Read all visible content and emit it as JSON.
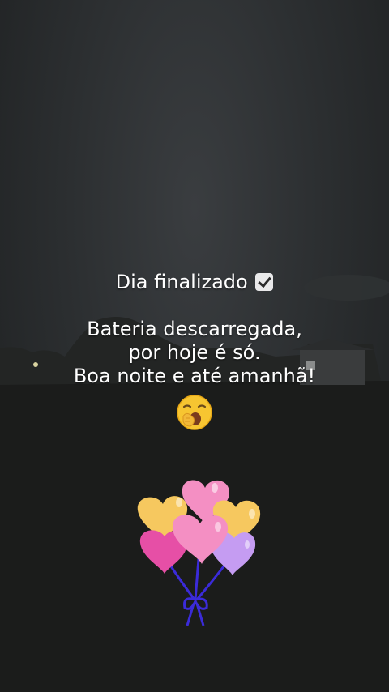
{
  "caption": {
    "line1": "Dia finalizado",
    "line1_icon": "check-mark-button-icon",
    "line2": "Bateria descarregada,",
    "line3": "por hoje é só.",
    "line4": "Boa noite e até amanhã!",
    "line5_icon": "yawning-face-icon"
  },
  "stickers": {
    "balloons_icon": "heart-balloons-icon",
    "colors": [
      "#f6c85f",
      "#f48fc3",
      "#e64fa6",
      "#c59cf2",
      "#3b2bd9"
    ]
  }
}
